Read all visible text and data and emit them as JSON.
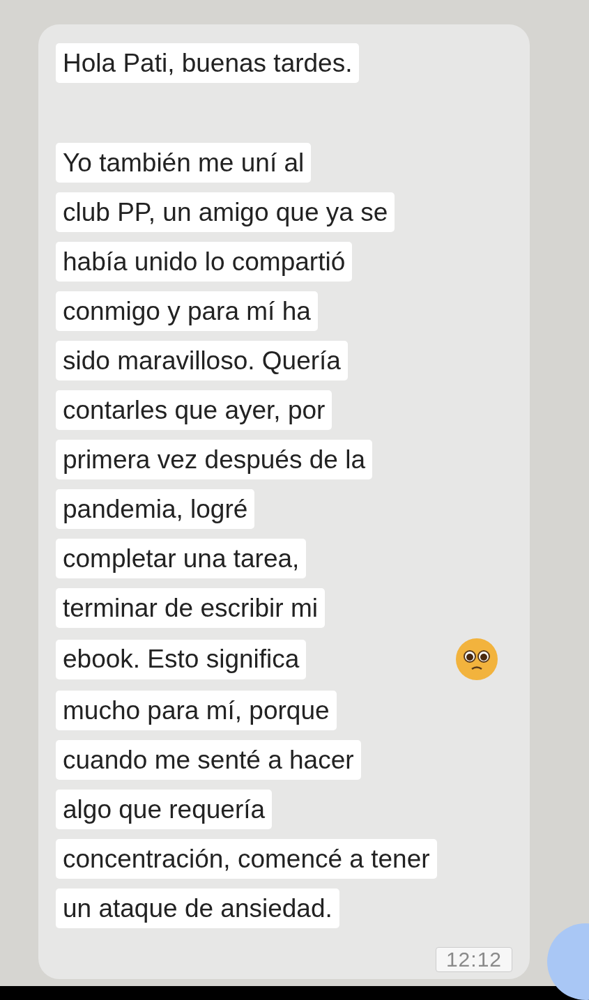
{
  "message": {
    "paragraphs": [
      [
        {
          "text": "Hola Pati, buenas tardes.",
          "emoji": false
        }
      ],
      [
        {
          "text": "Yo también me uní al",
          "emoji": false
        },
        {
          "text": "club PP, un amigo que ya se",
          "emoji": false
        },
        {
          "text": "había unido lo compartió",
          "emoji": false
        },
        {
          "text": "conmigo y para mí ha",
          "emoji": false
        },
        {
          "text": "sido maravilloso. Quería",
          "emoji": false
        },
        {
          "text": "contarles que ayer, por",
          "emoji": false
        },
        {
          "text": "primera vez después de la",
          "emoji": false
        },
        {
          "text": "pandemia, logré",
          "emoji": false
        },
        {
          "text": "completar una tarea,",
          "emoji": false
        },
        {
          "text": "terminar de escribir mi",
          "emoji": false
        },
        {
          "text": "ebook. Esto significa",
          "emoji": true
        },
        {
          "text": "mucho para mí, porque",
          "emoji": false
        },
        {
          "text": "cuando me senté a hacer",
          "emoji": false
        },
        {
          "text": "algo que requería",
          "emoji": false
        },
        {
          "text": "concentración, comencé a tener",
          "emoji": false
        },
        {
          "text": "un ataque de ansiedad.",
          "emoji": false
        }
      ]
    ],
    "time": "12:12"
  }
}
